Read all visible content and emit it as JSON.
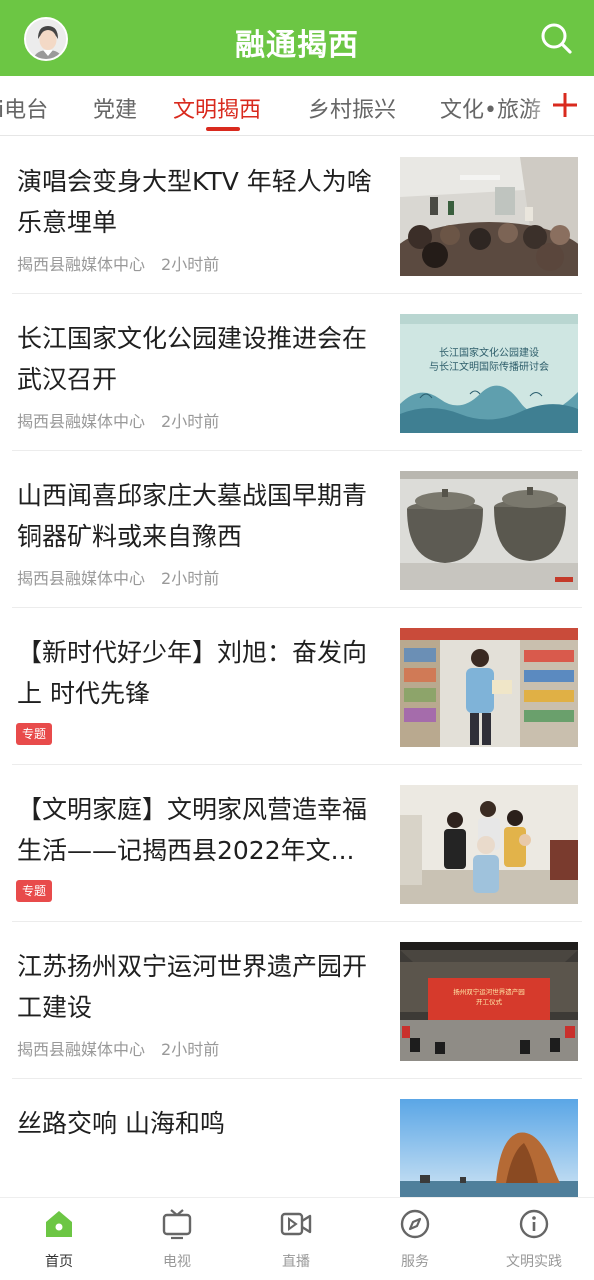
{
  "header": {
    "title": "融通揭西"
  },
  "tabs": [
    {
      "label": "i电台"
    },
    {
      "label": "党建"
    },
    {
      "label": "文明揭西"
    },
    {
      "label": "乡村振兴"
    },
    {
      "label": "文化•旅游"
    }
  ],
  "active_tab_index": 2,
  "articles": [
    {
      "title": "演唱会变身大型KTV 年轻人为啥乐意埋单",
      "source": "揭西县融媒体中心",
      "time": "2小时前",
      "tag": ""
    },
    {
      "title": "长江国家文化公园建设推进会在武汉召开",
      "source": "揭西县融媒体中心",
      "time": "2小时前",
      "tag": "",
      "image_text": [
        "长江国家文化公园建设",
        "与长江文明国际传播研讨会"
      ]
    },
    {
      "title": "山西闻喜邱家庄大墓战国早期青铜器矿料或来自豫西",
      "source": "揭西县融媒体中心",
      "time": "2小时前",
      "tag": ""
    },
    {
      "title": "【新时代好少年】刘旭：奋发向上 时代先锋",
      "source": "",
      "time": "",
      "tag": "专题"
    },
    {
      "title": "【文明家庭】文明家风营造幸福生活——记揭西县2022年文...",
      "source": "",
      "time": "",
      "tag": "专题"
    },
    {
      "title": "江苏扬州双宁运河世界遗产园开工建设",
      "source": "揭西县融媒体中心",
      "time": "2小时前",
      "tag": "",
      "image_text": [
        "扬州双宁运河世界遗产园",
        "开工仪式"
      ]
    },
    {
      "title": "丝路交响 山海和鸣",
      "source": "",
      "time": "",
      "tag": ""
    }
  ],
  "bottom_nav": [
    {
      "label": "首页",
      "icon": "home-icon",
      "active": true
    },
    {
      "label": "电视",
      "icon": "tv-icon",
      "active": false
    },
    {
      "label": "直播",
      "icon": "live-video-icon",
      "active": false
    },
    {
      "label": "服务",
      "icon": "compass-icon",
      "active": false
    },
    {
      "label": "文明实践",
      "icon": "info-icon",
      "active": false
    }
  ],
  "colors": {
    "brand_green": "#6cc644",
    "active_red": "#d92a1e",
    "tag_red": "#e84b4b",
    "meta_gray": "#999999"
  }
}
